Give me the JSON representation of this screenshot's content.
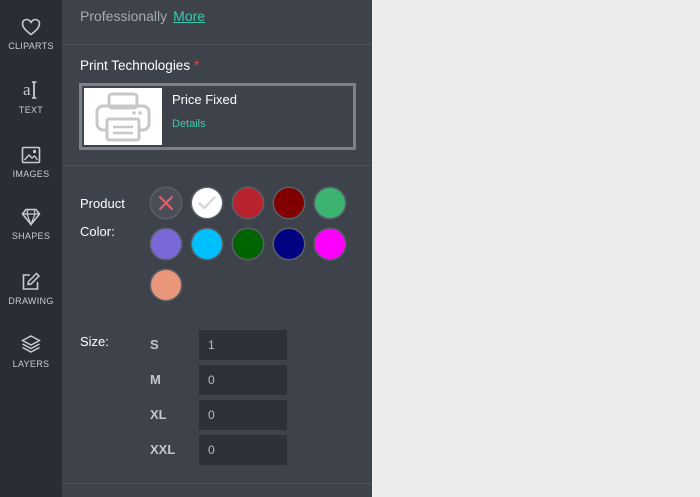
{
  "sidebar": {
    "items": [
      {
        "label": "CLIPARTS",
        "icon": "heart-icon"
      },
      {
        "label": "TEXT",
        "icon": "text-icon"
      },
      {
        "label": "IMAGES",
        "icon": "image-icon"
      },
      {
        "label": "SHAPES",
        "icon": "diamond-icon"
      },
      {
        "label": "DRAWING",
        "icon": "pencil-icon"
      },
      {
        "label": "LAYERS",
        "icon": "layers-icon"
      }
    ]
  },
  "description": {
    "text": "Professionally",
    "more_label": "More"
  },
  "print_tech": {
    "title": "Print Technologies",
    "required_mark": "*",
    "card": {
      "name": "Price Fixed",
      "details_label": "Details",
      "thumbnail_icon": "printer-icon"
    }
  },
  "product_color": {
    "label_line1": "Product",
    "label_line2": "Color:",
    "swatches": [
      {
        "name": "none",
        "color": "#4a4e57",
        "icon": "close-icon"
      },
      {
        "name": "white",
        "color": "#ffffff",
        "icon": "checkmark-icon",
        "selected": true
      },
      {
        "name": "red",
        "color": "#b8232d"
      },
      {
        "name": "maroon",
        "color": "#800000"
      },
      {
        "name": "green",
        "color": "#3cb371"
      },
      {
        "name": "purple",
        "color": "#7b68d8"
      },
      {
        "name": "light-blue",
        "color": "#00bfff"
      },
      {
        "name": "dark-green",
        "color": "#006400"
      },
      {
        "name": "navy",
        "color": "#000080"
      },
      {
        "name": "magenta",
        "color": "#ff00ff"
      },
      {
        "name": "salmon",
        "color": "#e9967a"
      }
    ]
  },
  "size": {
    "label": "Size:",
    "rows": [
      {
        "name": "S",
        "value": "1"
      },
      {
        "name": "M",
        "value": "0"
      },
      {
        "name": "XL",
        "value": "0"
      },
      {
        "name": "XXL",
        "value": "0"
      }
    ]
  },
  "colors": {
    "accent": "#3fc9b1",
    "panel_bg": "#3e424b",
    "rail_bg": "#2a2d33",
    "canvas_bg": "#ececee"
  }
}
